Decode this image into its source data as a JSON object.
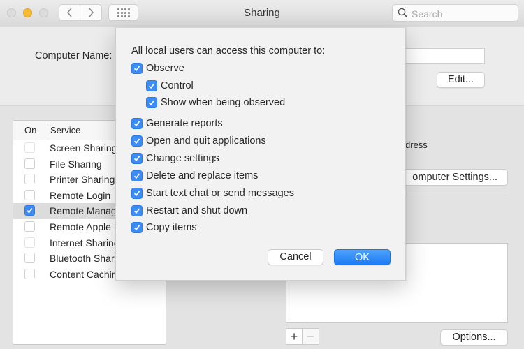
{
  "window": {
    "title": "Sharing",
    "search_placeholder": "Search",
    "icons": {
      "close": "traffic-light-close",
      "minimize": "traffic-light-minimize",
      "zoom": "traffic-light-zoom",
      "back": "chevron-left",
      "forward": "chevron-right",
      "show_all": "grid-dots",
      "search": "magnifier"
    },
    "colors": {
      "accent": "#3c8cf5",
      "minimize": "#f6bb31"
    }
  },
  "top": {
    "computer_name_label": "Computer Name:",
    "computer_name_value": "",
    "edit_button": "Edit..."
  },
  "services": {
    "header_on": "On",
    "header_service": "Service",
    "items": [
      {
        "label": "Screen Sharing",
        "checked": false,
        "dim": true
      },
      {
        "label": "File Sharing",
        "checked": false,
        "dim": false
      },
      {
        "label": "Printer Sharing",
        "checked": false,
        "dim": false
      },
      {
        "label": "Remote Login",
        "checked": false,
        "dim": false
      },
      {
        "label": "Remote Management",
        "checked": true,
        "dim": false,
        "selected": true
      },
      {
        "label": "Remote Apple Events",
        "checked": false,
        "dim": false
      },
      {
        "label": "Internet Sharing",
        "checked": false,
        "dim": true
      },
      {
        "label": "Bluetooth Sharing",
        "checked": false,
        "dim": false
      },
      {
        "label": "Content Caching",
        "checked": false,
        "dim": false
      }
    ]
  },
  "right": {
    "address_fragment": "dress",
    "computer_settings_button": "omputer Settings...",
    "add_button": "+",
    "remove_button": "−",
    "options_button": "Options..."
  },
  "modal": {
    "heading": "All local users can access this computer to:",
    "options": [
      {
        "label": "Observe",
        "checked": true,
        "indent": 0
      },
      {
        "label": "Control",
        "checked": true,
        "indent": 1
      },
      {
        "label": "Show when being observed",
        "checked": true,
        "indent": 1
      },
      {
        "label": "Generate reports",
        "checked": true,
        "indent": 0
      },
      {
        "label": "Open and quit applications",
        "checked": true,
        "indent": 0
      },
      {
        "label": "Change settings",
        "checked": true,
        "indent": 0
      },
      {
        "label": "Delete and replace items",
        "checked": true,
        "indent": 0
      },
      {
        "label": "Start text chat or send messages",
        "checked": true,
        "indent": 0
      },
      {
        "label": "Restart and shut down",
        "checked": true,
        "indent": 0
      },
      {
        "label": "Copy items",
        "checked": true,
        "indent": 0
      }
    ],
    "cancel_button": "Cancel",
    "ok_button": "OK"
  }
}
